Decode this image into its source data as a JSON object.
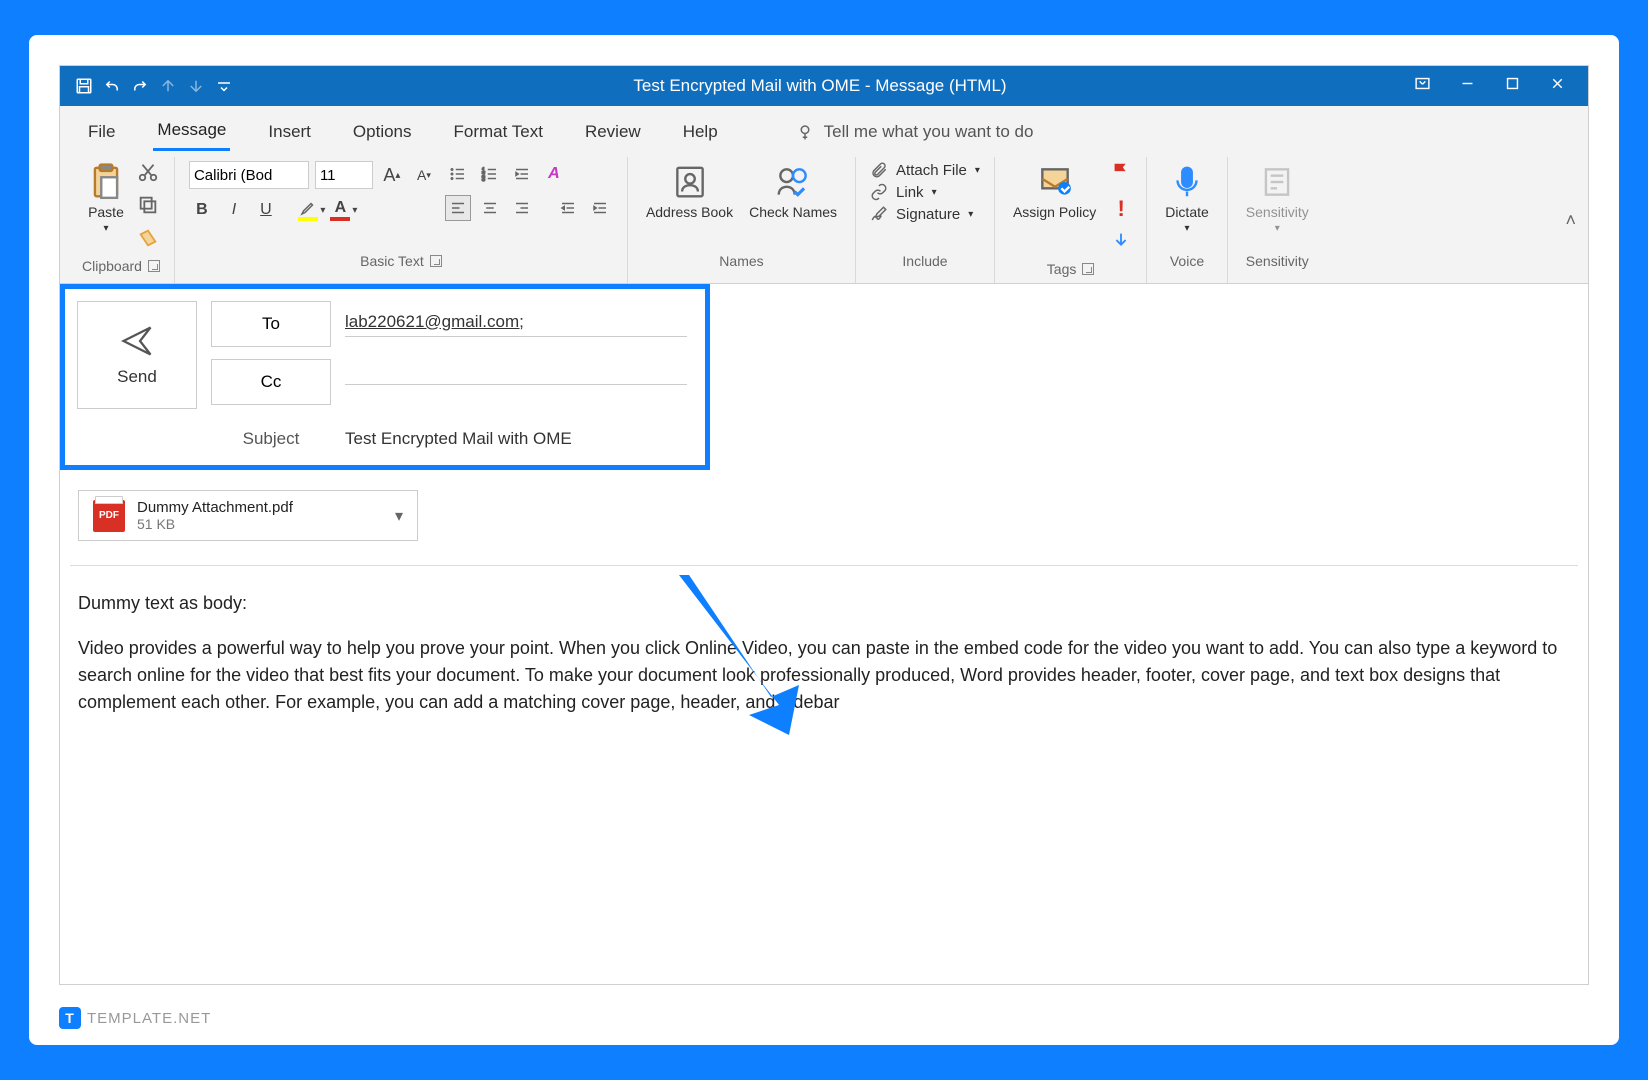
{
  "titleBar": {
    "title": "Test Encrypted Mail with OME  -  Message (HTML)"
  },
  "ribbonTabs": {
    "file": "File",
    "message": "Message",
    "insert": "Insert",
    "options": "Options",
    "formatText": "Format Text",
    "review": "Review",
    "help": "Help",
    "tellMe": "Tell me what you want to do"
  },
  "ribbon": {
    "clipboard": {
      "paste": "Paste",
      "label": "Clipboard"
    },
    "basicText": {
      "font": "Calibri (Bod",
      "size": "11",
      "label": "Basic Text"
    },
    "names": {
      "addressBook": "Address Book",
      "checkNames": "Check Names",
      "label": "Names"
    },
    "include": {
      "attachFile": "Attach File",
      "link": "Link",
      "signature": "Signature",
      "label": "Include"
    },
    "tags": {
      "assignPolicy": "Assign Policy",
      "label": "Tags"
    },
    "voice": {
      "dictate": "Dictate",
      "label": "Voice"
    },
    "sensitivity": {
      "btn": "Sensitivity",
      "label": "Sensitivity"
    }
  },
  "compose": {
    "send": "Send",
    "toLabel": "To",
    "toValue": "lab220621@gmail.com;",
    "ccLabel": "Cc",
    "ccValue": "",
    "subjectLabel": "Subject",
    "subjectValue": "Test Encrypted Mail with OME"
  },
  "attachment": {
    "name": "Dummy Attachment.pdf",
    "size": "51 KB",
    "iconLabel": "PDF"
  },
  "body": {
    "intro": "Dummy text as body:",
    "para": "Video provides a powerful way to help you prove your point. When you click Online Video, you can paste in the embed code for the video you want to add. You can also type a keyword to search online for the video that best fits your document. To make your document look professionally produced, Word provides header, footer, cover page, and text box designs that complement each other. For example, you can add a matching cover page, header, and sidebar"
  },
  "watermark": {
    "text": "TEMPLATE.NET"
  }
}
